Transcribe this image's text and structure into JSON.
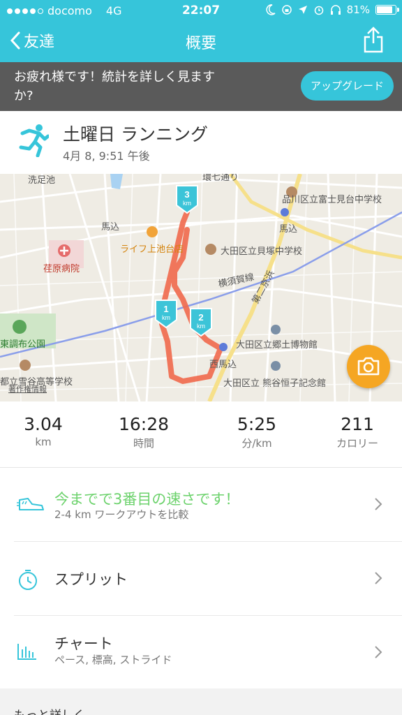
{
  "status_bar": {
    "carrier": "docomo",
    "network": "4G",
    "time": "22:07",
    "battery": "81%",
    "signal_bars": 4
  },
  "nav": {
    "back_label": "友達",
    "title": "概要"
  },
  "banner": {
    "message": "お疲れ様です！統計を詳しく見ますか?",
    "upgrade_label": "アップグレード"
  },
  "activity": {
    "title": "土曜日 ランニング",
    "date": "4月 8, 9:51 午後"
  },
  "map": {
    "labels": {
      "senzoku": "洗足池",
      "magome": "馬込",
      "ebara_hospital": "荏原病院",
      "life": "ライフ上池台店",
      "kaizuka": "大田区立貝塚中学校",
      "yokosuka": "横須賀線",
      "daini_keihin": "第二京浜",
      "shinagawa": "品川区立富士見台中学校",
      "magome_station": "馬込",
      "chofu_park": "東調布公園",
      "yukigaya": "都立雪谷高等学校",
      "copyright": "著作権情報",
      "nishimagome": "西馬込",
      "kyodo": "大田区立郷土博物館",
      "kumagai": "大田区立 熊谷恒子記念館",
      "kanpachi": "環七通り"
    },
    "km_markers": [
      "1",
      "2",
      "3"
    ],
    "km_unit": "km",
    "colors": {
      "route": "#f06b4f",
      "marker": "#3cc4d8",
      "camera": "#f5a623"
    }
  },
  "stats": [
    {
      "value": "3.04",
      "unit": "km"
    },
    {
      "value": "16:28",
      "unit": "時間"
    },
    {
      "value": "5:25",
      "unit": "分/km"
    },
    {
      "value": "211",
      "unit": "カロリー"
    }
  ],
  "rows": {
    "achievement": {
      "title": "今までで3番目の速さです！",
      "subtitle": "2-4 km ワークアウトを比較"
    },
    "splits": {
      "title": "スプリット"
    },
    "chart": {
      "title": "チャート",
      "subtitle": "ペース, 標高, ストライド"
    }
  },
  "more_label": "もっと詳しく",
  "icons": {
    "back": "chevron-left-icon",
    "share": "share-icon",
    "runner": "runner-icon",
    "shoe": "running-shoe-icon",
    "stopwatch": "stopwatch-icon",
    "chart": "bar-chart-icon",
    "chevron": "chevron-right-icon",
    "camera": "camera-icon"
  }
}
